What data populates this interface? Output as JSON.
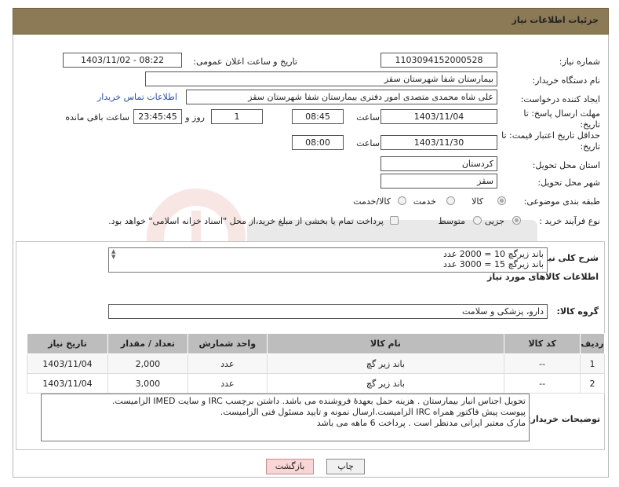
{
  "header": {
    "title": "جزئیات اطلاعات نیاز"
  },
  "form": {
    "need_number_label": "شماره نیاز:",
    "need_number": "1103094152000528",
    "announce_label": "تاریخ و ساعت اعلان عمومی:",
    "announce_value": "1403/11/02 - 08:22",
    "buyer_org_label": "نام دستگاه خریدار:",
    "buyer_org": "بیمارستان شفا شهرستان سقز",
    "requester_label": "ایجاد کننده درخواست:",
    "requester": "علی شاه محمدی متصدی امور دفتری بیمارستان شفا شهرستان سقز",
    "buyer_contact_link": "اطلاعات تماس خریدار",
    "deadline_label": "مهلت ارسال پاسخ: تا تاریخ:",
    "deadline_date": "1403/11/04",
    "time_label": "ساعت",
    "deadline_time": "08:45",
    "days_value": "1",
    "days_label": "روز و",
    "remaining_time": "23:45:45",
    "remaining_label": "ساعت باقی مانده",
    "validity_label": "حداقل تاریخ اعتبار قیمت: تا تاریخ:",
    "validity_date": "1403/11/30",
    "validity_time": "08:00",
    "province_label": "استان محل تحویل:",
    "province": "کردستان",
    "city_label": "شهر محل تحویل:",
    "city": "سقز",
    "category_label": "طبقه بندی موضوعی:",
    "category_options": [
      "کالا",
      "خدمت",
      "کالا/خدمت"
    ],
    "process_label": "نوع فرآیند خرید :",
    "process_options": [
      "جزیی",
      "متوسط"
    ],
    "payment_note": "پرداخت تمام یا بخشی از مبلغ خرید،از محل \"اسناد خزانه اسلامی\" خواهد بود."
  },
  "summary": {
    "label": "شرح کلی نیاز:",
    "lines": [
      "باند زیرگچ 10 = 2000 عدد",
      "باند زیرگچ 15 = 3000 عدد"
    ]
  },
  "goods": {
    "section_title": "اطلاعات کالاهای مورد نیاز",
    "group_label": "گروه کالا:",
    "group_value": "دارو، پزشکی و سلامت",
    "columns": [
      "ردیف",
      "کد کالا",
      "نام کالا",
      "واحد شمارش",
      "تعداد / مقدار",
      "تاریخ نیاز"
    ],
    "rows": [
      [
        "1",
        "--",
        "باند زیر گچ",
        "عدد",
        "2,000",
        "1403/11/04"
      ],
      [
        "2",
        "--",
        "باند زیر گچ",
        "عدد",
        "3,000",
        "1403/11/04"
      ]
    ]
  },
  "buyer_notes": {
    "label": "توضیحات خریدار:",
    "lines": [
      "تحویل اجناس  انبار بیمارستان . هزینه حمل بعهدهٔ فروشنده می باشد.  داشتن برچسب IRC  و سایت  IMED  الزامیست.",
      "پیوست پیش فاکتور همراه IRC  الزامیست.ارسال نمونه و تایید مسئول فنی الزامیست.",
      "مارک معتبر ایرانی مدنظر است . پرداخت 6  ماهه می باشد"
    ]
  },
  "buttons": {
    "print": "چاپ",
    "back": "بازگشت"
  },
  "colors": {
    "header": "#8c7a56",
    "table_header": "#bdbdbd",
    "back_button": "#f9d6d6",
    "link": "#2a4fa0"
  }
}
